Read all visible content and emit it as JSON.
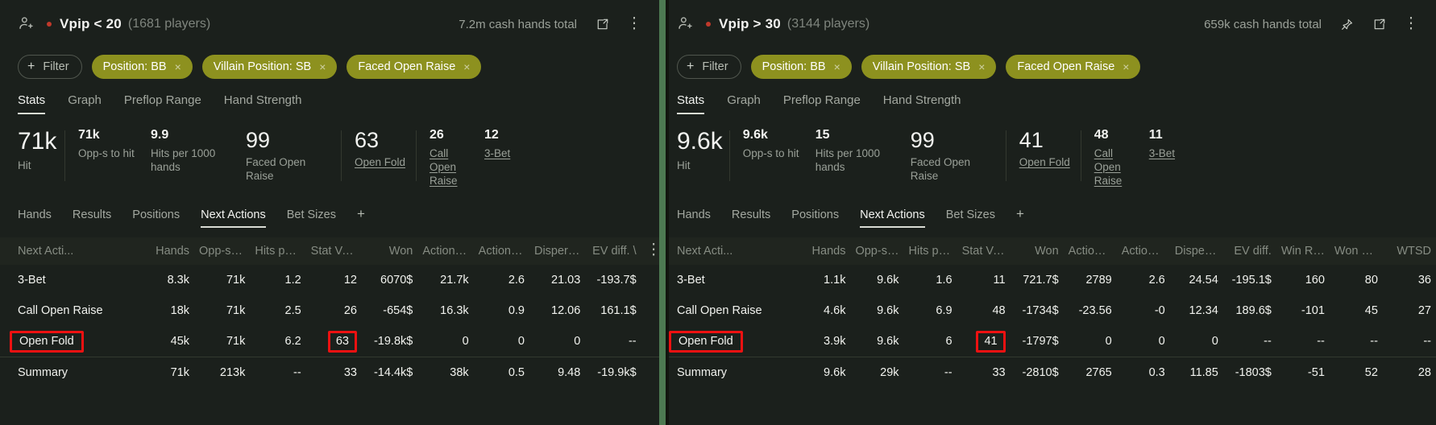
{
  "panels": [
    {
      "id": "left",
      "header": {
        "person_icon": "person-add-icon",
        "status_dot_color": "#c0392b",
        "title": "Vpip < 20",
        "players": "(1681 players)",
        "hands_total": "7.2m cash hands total",
        "icons": [
          "popout-icon",
          "kebab-menu-icon"
        ]
      },
      "filters": {
        "add_label": "Filter",
        "chips": [
          {
            "label": "Position: BB",
            "remove": "×"
          },
          {
            "label": "Villain Position: SB",
            "remove": "×"
          },
          {
            "label": "Faced Open Raise",
            "remove": "×"
          }
        ]
      },
      "view_tabs": [
        {
          "label": "Stats",
          "active": true
        },
        {
          "label": "Graph",
          "active": false
        },
        {
          "label": "Preflop Range",
          "active": false
        },
        {
          "label": "Hand Strength",
          "active": false
        }
      ],
      "kpis": [
        {
          "value": "71k",
          "label": "Hit",
          "size": "xl",
          "link": false
        },
        {
          "value": "71k",
          "label": "Opp-s to hit",
          "size": "sm",
          "link": false
        },
        {
          "value": "9.9",
          "label": "Hits per 1000 hands",
          "size": "sm",
          "link": false
        },
        {
          "value": "99",
          "label": "Faced Open Raise",
          "size": "lg",
          "link": false
        },
        {
          "value": "63",
          "label": "Open Fold",
          "size": "lg",
          "link": true
        },
        {
          "value": "26",
          "label": "Call Open Raise",
          "size": "sm",
          "link": true
        },
        {
          "value": "12",
          "label": "3-Bet",
          "size": "sm",
          "link": true
        }
      ],
      "sub_tabs": [
        {
          "label": "Hands",
          "active": false
        },
        {
          "label": "Results",
          "active": false
        },
        {
          "label": "Positions",
          "active": false
        },
        {
          "label": "Next Actions",
          "active": true
        },
        {
          "label": "Bet Sizes",
          "active": false
        }
      ],
      "sub_tabs_add": "+",
      "table": {
        "columns": [
          "Next Acti...",
          "Hands",
          "Opp-s to ...",
          "Hits per 1...",
          "Stat Value",
          "Won",
          "Action Pro...",
          "Action Pro...",
          "Dispersio...",
          "EV diff. \\"
        ],
        "kebab": "column-options-icon",
        "rows": [
          {
            "cells": [
              "3-Bet",
              "8.3k",
              "71k",
              "1.2",
              "12",
              "6070$",
              "21.7k",
              "2.6",
              "21.03",
              "-193.7$"
            ],
            "colors": [
              "",
              "",
              "",
              "",
              "",
              "pos",
              "pos",
              "pos",
              "",
              "neg"
            ],
            "highlight": []
          },
          {
            "cells": [
              "Call Open Raise",
              "18k",
              "71k",
              "2.5",
              "26",
              "-654$",
              "16.3k",
              "0.9",
              "12.06",
              "161.1$"
            ],
            "colors": [
              "",
              "",
              "",
              "",
              "",
              "neg",
              "pos",
              "pos",
              "",
              "pos"
            ],
            "highlight": []
          },
          {
            "cells": [
              "Open Fold",
              "45k",
              "71k",
              "6.2",
              "63",
              "-19.8k$",
              "0",
              "0",
              "0",
              "--"
            ],
            "colors": [
              "",
              "",
              "",
              "",
              "",
              "neg",
              "pos",
              "pos",
              "",
              ""
            ],
            "highlight": [
              0,
              4
            ]
          }
        ],
        "summary": {
          "cells": [
            "Summary",
            "71k",
            "213k",
            "--",
            "33",
            "-14.4k$",
            "38k",
            "0.5",
            "9.48",
            "-19.9k$"
          ],
          "colors": [
            "",
            "",
            "",
            "",
            "",
            "neg",
            "pos",
            "pos",
            "",
            "neg"
          ]
        }
      }
    },
    {
      "id": "right",
      "header": {
        "person_icon": "person-add-icon",
        "status_dot_color": "#c0392b",
        "title": "Vpip > 30",
        "players": "(3144 players)",
        "hands_total": "659k cash hands total",
        "icons": [
          "pin-icon",
          "popout-icon",
          "kebab-menu-icon"
        ]
      },
      "filters": {
        "add_label": "Filter",
        "chips": [
          {
            "label": "Position: BB",
            "remove": "×"
          },
          {
            "label": "Villain Position: SB",
            "remove": "×"
          },
          {
            "label": "Faced Open Raise",
            "remove": "×"
          }
        ]
      },
      "view_tabs": [
        {
          "label": "Stats",
          "active": true
        },
        {
          "label": "Graph",
          "active": false
        },
        {
          "label": "Preflop Range",
          "active": false
        },
        {
          "label": "Hand Strength",
          "active": false
        }
      ],
      "kpis": [
        {
          "value": "9.6k",
          "label": "Hit",
          "size": "xl",
          "link": false
        },
        {
          "value": "9.6k",
          "label": "Opp-s to hit",
          "size": "sm",
          "link": false
        },
        {
          "value": "15",
          "label": "Hits per 1000 hands",
          "size": "sm",
          "link": false
        },
        {
          "value": "99",
          "label": "Faced Open Raise",
          "size": "lg",
          "link": false
        },
        {
          "value": "41",
          "label": "Open Fold",
          "size": "lg",
          "link": true
        },
        {
          "value": "48",
          "label": "Call Open Raise",
          "size": "sm",
          "link": true
        },
        {
          "value": "11",
          "label": "3-Bet",
          "size": "sm",
          "link": true
        }
      ],
      "sub_tabs": [
        {
          "label": "Hands",
          "active": false
        },
        {
          "label": "Results",
          "active": false
        },
        {
          "label": "Positions",
          "active": false
        },
        {
          "label": "Next Actions",
          "active": true
        },
        {
          "label": "Bet Sizes",
          "active": false
        }
      ],
      "sub_tabs_add": "+",
      "table": {
        "columns": [
          "Next Acti...",
          "Hands",
          "Opp-s to ...",
          "Hits per 1...",
          "Stat Value",
          "Won",
          "Action Pro...",
          "Action Pro...",
          "Dispersio...",
          "EV diff.",
          "Win Rate ...",
          "Won Hand",
          "WTSD"
        ],
        "kebab": "",
        "rows": [
          {
            "cells": [
              "3-Bet",
              "1.1k",
              "9.6k",
              "1.6",
              "11",
              "721.7$",
              "2789",
              "2.6",
              "24.54",
              "-195.1$",
              "160",
              "80",
              "36"
            ],
            "colors": [
              "",
              "",
              "",
              "",
              "",
              "pos",
              "pos",
              "pos",
              "",
              "neg",
              "pos",
              "",
              ""
            ],
            "highlight": []
          },
          {
            "cells": [
              "Call Open Raise",
              "4.6k",
              "9.6k",
              "6.9",
              "48",
              "-1734$",
              "-23.56",
              "-0",
              "12.34",
              "189.6$",
              "-101",
              "45",
              "27"
            ],
            "colors": [
              "",
              "",
              "",
              "",
              "",
              "neg",
              "neg",
              "neg",
              "",
              "pos",
              "neg",
              "",
              ""
            ],
            "highlight": []
          },
          {
            "cells": [
              "Open Fold",
              "3.9k",
              "9.6k",
              "6",
              "41",
              "-1797$",
              "0",
              "0",
              "0",
              "--",
              "--",
              "--",
              "--"
            ],
            "colors": [
              "",
              "",
              "",
              "",
              "",
              "neg",
              "pos",
              "pos",
              "",
              "",
              "",
              "",
              ""
            ],
            "highlight": [
              0,
              4
            ]
          }
        ],
        "summary": {
          "cells": [
            "Summary",
            "9.6k",
            "29k",
            "--",
            "33",
            "-2810$",
            "2765",
            "0.3",
            "11.85",
            "-1803$",
            "-51",
            "52",
            "28"
          ],
          "colors": [
            "",
            "",
            "",
            "",
            "",
            "neg",
            "pos",
            "pos",
            "",
            "neg",
            "neg",
            "",
            ""
          ]
        }
      }
    }
  ],
  "colors": {
    "accent_chip": "#8d911f",
    "positive": "#76c37a",
    "negative": "#e07a6a",
    "highlight_box": "#ee1111",
    "divider_green": "#4d7a52",
    "background": "#1b201c"
  }
}
